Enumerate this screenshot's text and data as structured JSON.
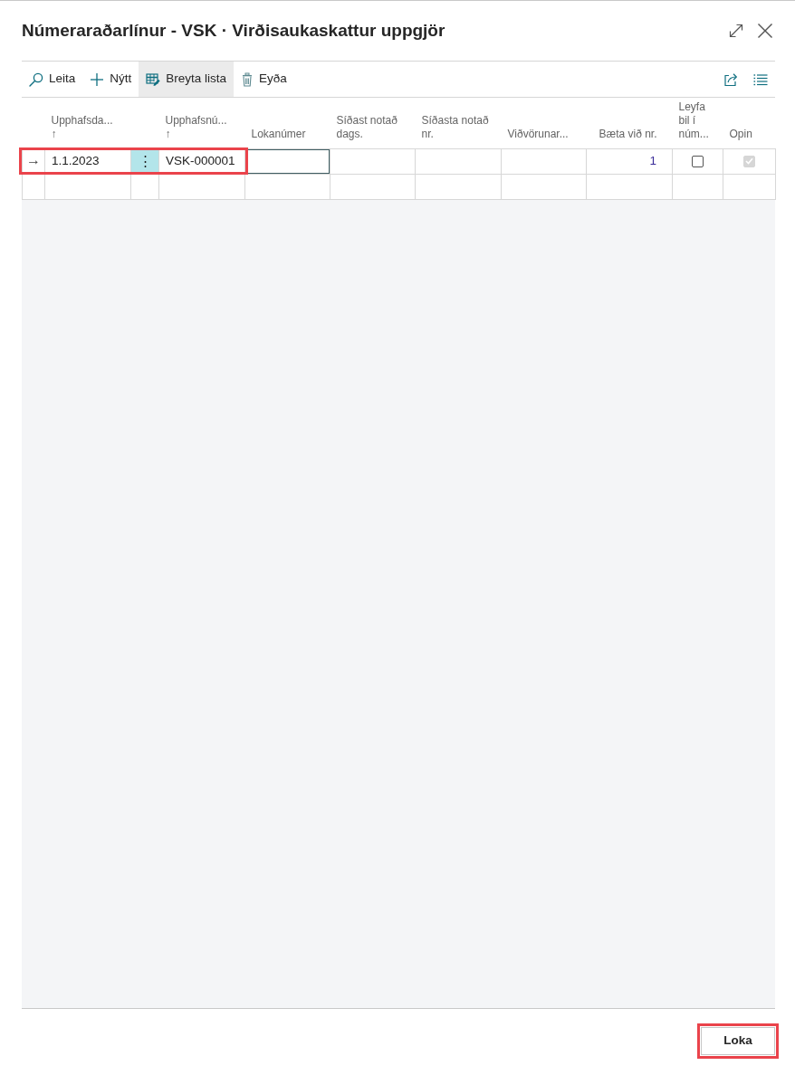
{
  "dialog": {
    "title": "Númeraraðarlínur - VSK · Virðisaukaskattur uppgjör"
  },
  "toolbar": {
    "actions": [
      {
        "kind": "search",
        "label": "Leita",
        "active": false
      },
      {
        "kind": "new",
        "label": "Nýtt",
        "active": false
      },
      {
        "kind": "edit_list",
        "label": "Breyta lista",
        "active": true
      },
      {
        "kind": "delete",
        "label": "Eyða",
        "active": false
      }
    ]
  },
  "table": {
    "columns": [
      {
        "label": "Upphafsda...",
        "sort": "↑"
      },
      {
        "label": "Upphafsnú...",
        "sort": "↑"
      },
      {
        "label": "Lokanúmer"
      },
      {
        "label": "Síðast notað dags."
      },
      {
        "label": "Síðasta notað nr."
      },
      {
        "label": "Viðvörunar..."
      },
      {
        "label": "Bæta við nr."
      },
      {
        "label": "Leyfa bil í núm..."
      },
      {
        "label": "Opin"
      }
    ],
    "rows": [
      {
        "current": true,
        "highlighted": true,
        "marker": "→",
        "menu": "⋮",
        "cells": [
          {
            "kind": "text",
            "value": "1.1.2023"
          },
          {
            "kind": "text",
            "value": "VSK-000001"
          },
          {
            "kind": "input",
            "focused": true
          },
          {
            "kind": "empty"
          },
          {
            "kind": "empty"
          },
          {
            "kind": "empty"
          },
          {
            "kind": "number",
            "value": "1"
          },
          {
            "kind": "checkbox",
            "checked": false,
            "disabled": false
          },
          {
            "kind": "checkbox",
            "checked": true,
            "disabled": true
          }
        ]
      },
      {
        "current": false,
        "highlighted": false
      }
    ]
  },
  "footer": {
    "buttons": [
      {
        "label": "Loka",
        "highlighted": true
      }
    ]
  }
}
